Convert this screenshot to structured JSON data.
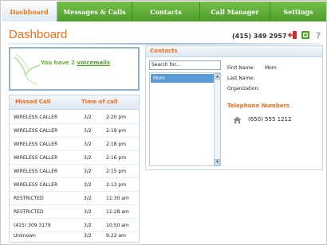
{
  "tabs": [
    {
      "label": "Dashboard",
      "active": true
    },
    {
      "label": "Messages & Calls",
      "active": false
    },
    {
      "label": "Contacts",
      "active": false
    },
    {
      "label": "Call Manager",
      "active": false
    },
    {
      "label": "Settings",
      "active": false
    }
  ],
  "header": {
    "title": "Dashboard",
    "phone": "(415) 349 2957",
    "icons": [
      "logout-icon",
      "refresh-icon",
      "help-icon"
    ]
  },
  "voicemail": {
    "prefix": "You have 2 ",
    "link": "voicemails"
  },
  "missed_calls": {
    "col_caller": "Missed Call",
    "col_time": "Time of call",
    "rows": [
      {
        "caller": "WIRELESS CALLER",
        "date": "3/2",
        "time": "2:20 pm"
      },
      {
        "caller": "WIRELESS CALLER",
        "date": "3/2",
        "time": "2:19 pm"
      },
      {
        "caller": "WIRELESS CALLER",
        "date": "3/2",
        "time": "2:18 pm"
      },
      {
        "caller": "WIRELESS CALLER",
        "date": "3/2",
        "time": "2:16 pm"
      },
      {
        "caller": "WIRELESS CALLER",
        "date": "3/2",
        "time": "2:15 pm"
      },
      {
        "caller": "WIRELESS CALLER",
        "date": "3/2",
        "time": "2:13 pm"
      },
      {
        "caller": "RESTRICTED",
        "date": "3/2",
        "time": "11:30 am"
      },
      {
        "caller": "RESTRICTED",
        "date": "3/2",
        "time": "11:28 am"
      },
      {
        "caller": "(415) 309 3179",
        "date": "3/2",
        "time": "10:50 am"
      },
      {
        "caller": "Unknown",
        "date": "3/2",
        "time": "9:22 am"
      }
    ]
  },
  "contacts": {
    "title": "Contacts",
    "search_value": "Search for...",
    "list": [
      "Mom"
    ],
    "detail": {
      "first_name_label": "First Name:",
      "first_name_value": "Mom",
      "last_name_label": "Last Name:",
      "last_name_value": "",
      "organization_label": "Organization:",
      "organization_value": "",
      "telephone_title": "Telephone Numbers",
      "telephone": "(650) 555 1212"
    }
  },
  "colors": {
    "accent_orange": "#f06e1e",
    "tab_green": "#5aa832",
    "selection_blue": "#5b9bd5"
  }
}
